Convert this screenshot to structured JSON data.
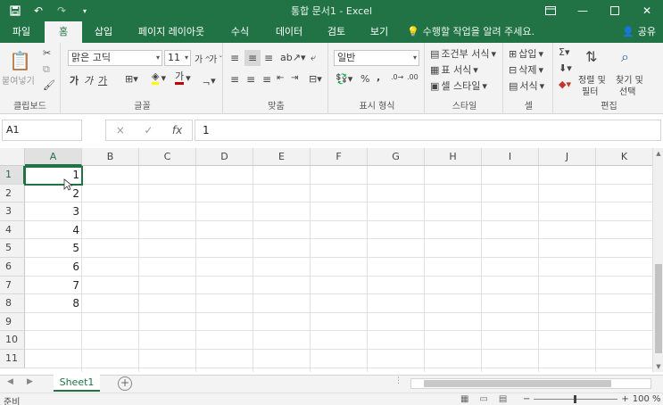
{
  "titlebar": {
    "title": "통합 문서1 - Excel",
    "qat": {
      "save_icon": "save-icon",
      "undo_icon": "undo-icon",
      "redo_icon": "redo-icon",
      "customize_icon": "chevron-down-icon"
    },
    "controls": {
      "ribbon_options": "ribbon-display-icon",
      "minimize": "minimize-icon",
      "maximize": "maximize-icon",
      "close": "close-icon"
    }
  },
  "tabs": [
    "파일",
    "홈",
    "삽입",
    "페이지 레이아웃",
    "수식",
    "데이터",
    "검토",
    "보기"
  ],
  "active_tab": "홈",
  "tell_me": "수행할 작업을 알려 주세요.",
  "share": "공유",
  "ribbon": {
    "clipboard": {
      "paste": "붙여넣기",
      "label": "클립보드"
    },
    "font": {
      "name": "맑은 고딕",
      "size": "11",
      "bold": "가",
      "italic": "가",
      "underline": "가",
      "font_color_glyph": "가",
      "label": "글꼴"
    },
    "alignment": {
      "label": "맞춤"
    },
    "number": {
      "format": "일반",
      "percent": "%",
      "comma": ",",
      "label": "표시 형식"
    },
    "styles": {
      "conditional": "조건부 서식",
      "table": "표 서식",
      "cell": "셀 스타일",
      "label": "스타일"
    },
    "cells": {
      "insert": "삽입",
      "delete": "삭제",
      "format": "서식",
      "label": "셀"
    },
    "editing": {
      "sort": "정렬 및",
      "filter": "필터",
      "find": "찾기 및",
      "select": "선택",
      "label": "편집"
    }
  },
  "formula_bar": {
    "name_box": "A1",
    "value": "1",
    "fx": "fx",
    "cancel": "×",
    "enter": "✓"
  },
  "grid": {
    "columns": [
      "A",
      "B",
      "C",
      "D",
      "E",
      "F",
      "G",
      "H",
      "I",
      "J",
      "K"
    ],
    "rows": [
      "1",
      "2",
      "3",
      "4",
      "5",
      "6",
      "7",
      "8",
      "9",
      "10",
      "11"
    ],
    "column_a_values": [
      "1",
      "2",
      "3",
      "4",
      "5",
      "6",
      "7",
      "8"
    ],
    "selected_cell": "A1"
  },
  "sheet_tabs": [
    "Sheet1"
  ],
  "status": {
    "text": "준비",
    "zoom": "100 %",
    "zoom_minus": "−",
    "zoom_plus": "+"
  },
  "colors": {
    "accent": "#217346"
  }
}
